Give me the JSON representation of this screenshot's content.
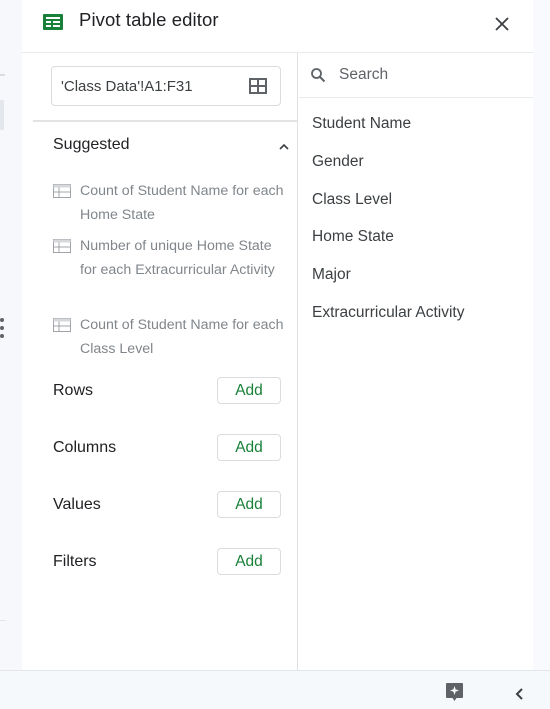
{
  "header": {
    "title": "Pivot table editor",
    "app_icon": "sheets-table-icon",
    "close_icon": "close-icon"
  },
  "range": {
    "value": "'Class Data'!A1:F31",
    "select_icon": "grid-select-icon"
  },
  "suggested": {
    "heading": "Suggested",
    "collapse_icon": "chevron-up-icon",
    "items": [
      {
        "icon": "pivot-table-icon",
        "label": "Count of Student Name for each Home State"
      },
      {
        "icon": "pivot-table-icon",
        "label": "Number of unique Home State for each Extracurricular Activity"
      },
      {
        "icon": "pivot-table-icon",
        "label": "Count of Student Name for each Class Level"
      }
    ]
  },
  "sections": [
    {
      "label": "Rows",
      "button": "Add"
    },
    {
      "label": "Columns",
      "button": "Add"
    },
    {
      "label": "Values",
      "button": "Add"
    },
    {
      "label": "Filters",
      "button": "Add"
    }
  ],
  "fields": {
    "search_placeholder": "Search",
    "items": [
      "Student Name",
      "Gender",
      "Class Level",
      "Home State",
      "Major",
      "Extracurricular Activity"
    ]
  },
  "bottom_bar": {
    "explore_icon": "explore-icon",
    "collapse_icon": "chevron-left-icon"
  },
  "colors": {
    "accent_green": "#188038",
    "sheets_green": "#188038",
    "text_primary": "#202124",
    "text_secondary": "#80868b"
  }
}
